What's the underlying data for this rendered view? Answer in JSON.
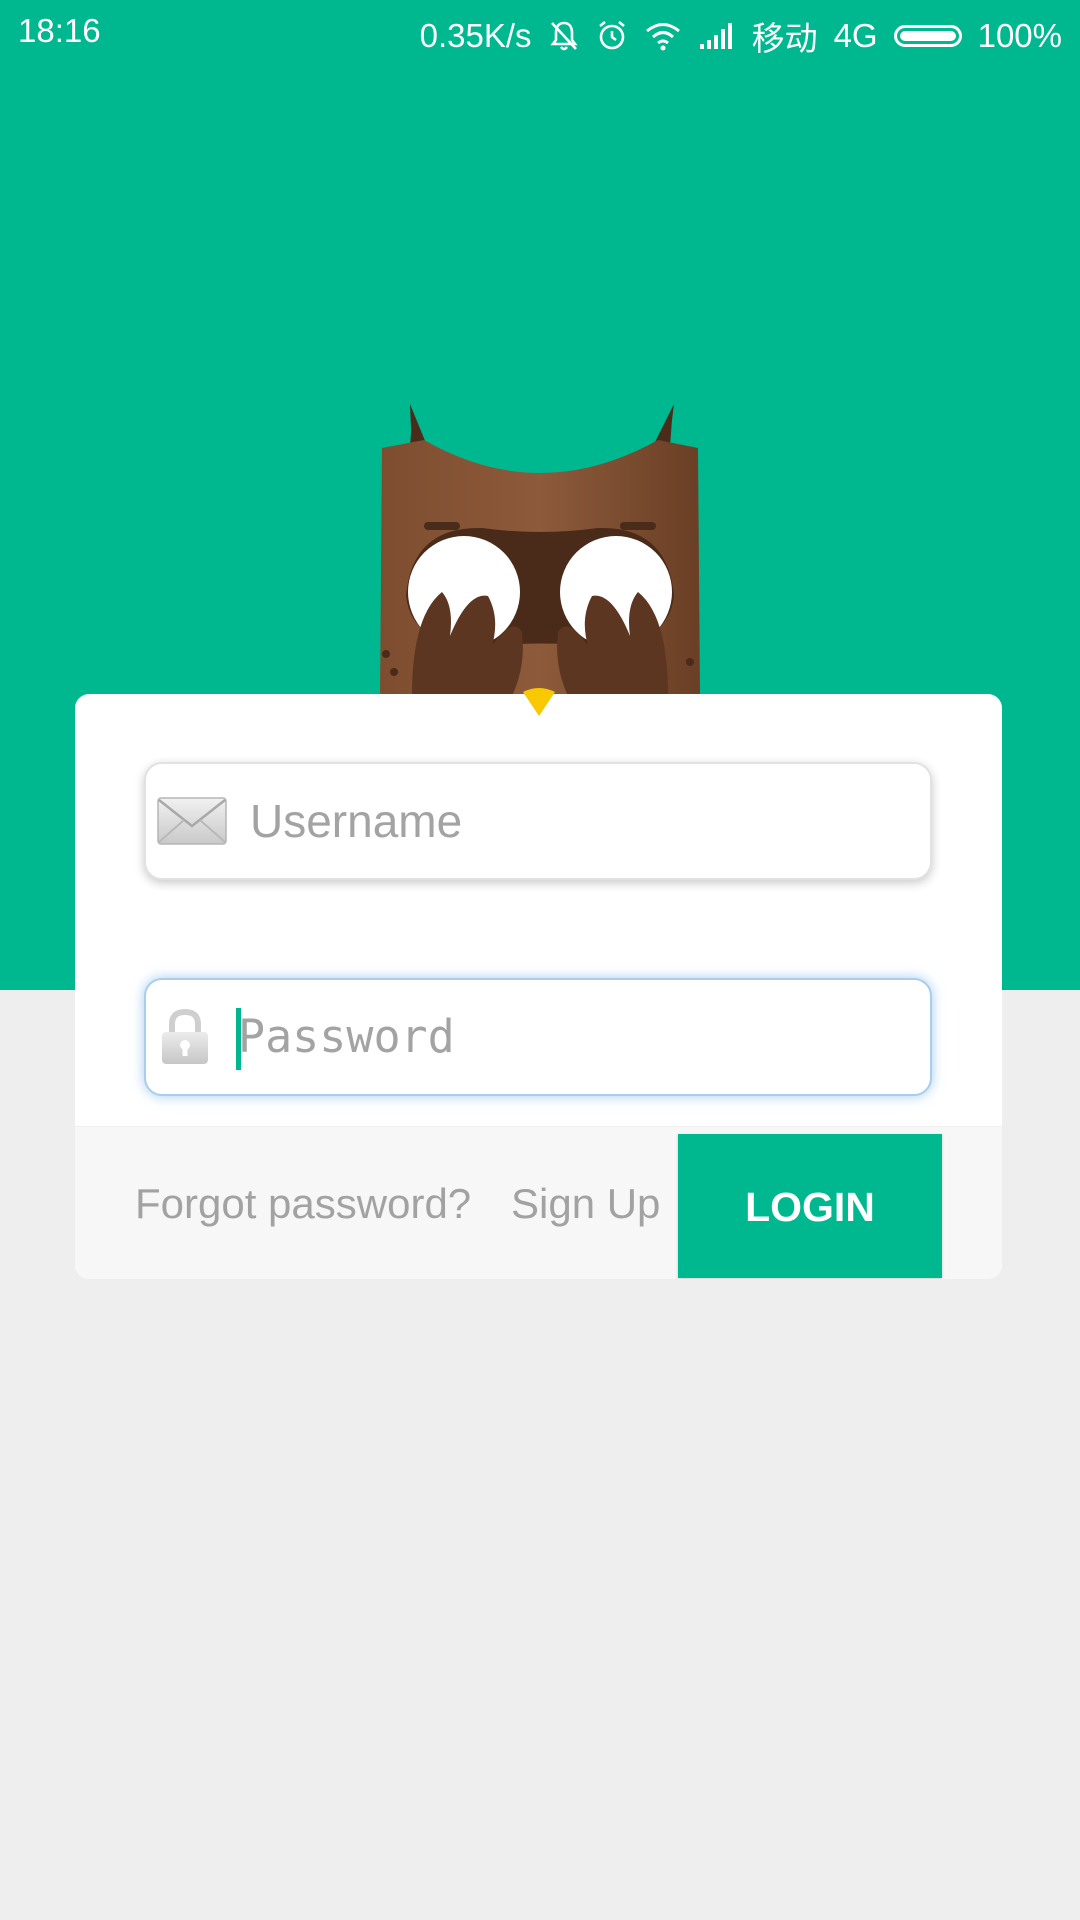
{
  "status_bar": {
    "time": "18:16",
    "network_speed": "0.35K/s",
    "carrier": "移动",
    "network_type": "4G",
    "battery": "100%",
    "battery_level": 1.0
  },
  "form": {
    "username_placeholder": "Username",
    "password_placeholder": "Password"
  },
  "footer": {
    "forgot_label": "Forgot password?",
    "signup_label": "Sign Up",
    "login_label": "LOGIN"
  },
  "colors": {
    "accent": "#00b890",
    "background": "#eeeeee",
    "owl_brown": "#7a4a2e",
    "beak": "#f8c800"
  },
  "icons": {
    "username": "envelope-icon",
    "password": "lock-icon"
  }
}
